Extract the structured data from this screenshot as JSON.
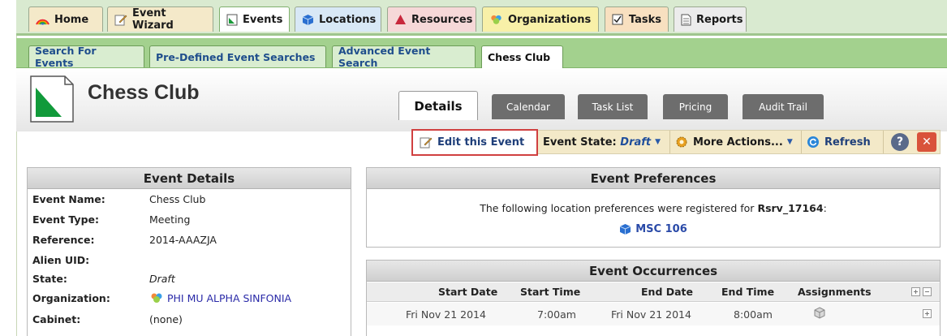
{
  "nav": {
    "tabs": [
      {
        "label": "Home",
        "icon": "rainbow-icon",
        "bg": "#f4e9c9"
      },
      {
        "label": "Event Wizard",
        "icon": "pencil-icon",
        "bg": "#f4e9c9"
      },
      {
        "label": "Events",
        "icon": "document-icon",
        "bg": "#ffffff"
      },
      {
        "label": "Locations",
        "icon": "cube-icon",
        "bg": "#d8e8f6"
      },
      {
        "label": "Resources",
        "icon": "triangle-icon",
        "bg": "#f6d8d8"
      },
      {
        "label": "Organizations",
        "icon": "people-icon",
        "bg": "#f8f0a8"
      },
      {
        "label": "Tasks",
        "icon": "checkbox-icon",
        "bg": "#f8e0c0"
      },
      {
        "label": "Reports",
        "icon": "report-icon",
        "bg": "#ececec"
      }
    ]
  },
  "subnav": {
    "tabs": [
      "Search For Events",
      "Pre-Defined Event Searches",
      "Advanced Event Search",
      "Chess Club"
    ]
  },
  "page_title": "Chess Club",
  "detail_tabs": [
    "Details",
    "Calendar",
    "Task List",
    "Pricing",
    "Audit Trail"
  ],
  "actions": {
    "edit": "Edit this Event",
    "state_label": "Event State:",
    "state_value": "Draft",
    "more": "More Actions...",
    "refresh": "Refresh"
  },
  "event_details": {
    "title": "Event Details",
    "rows": [
      {
        "key": "Event Name:",
        "value": "Chess Club"
      },
      {
        "key": "Event Type:",
        "value": "Meeting"
      },
      {
        "key": "Reference:",
        "value": "2014-AAAZJA"
      },
      {
        "key": "Alien UID:",
        "value": ""
      },
      {
        "key": "State:",
        "value": "Draft"
      },
      {
        "key": "Organization:",
        "value": "PHI MU ALPHA SINFONIA"
      },
      {
        "key": "Cabinet:",
        "value": "(none)"
      }
    ]
  },
  "event_preferences": {
    "title": "Event Preferences",
    "text": "The following location preferences were registered for",
    "reservation": "Rsrv_17164",
    "reservation_suffix": ":",
    "location": "MSC 106"
  },
  "event_occurrences": {
    "title": "Event Occurrences",
    "columns": [
      "Start Date",
      "Start Time",
      "End Date",
      "End Time",
      "Assignments"
    ],
    "rows": [
      {
        "start_date": "Fri Nov 21 2014",
        "start_time": "7:00am",
        "end_date": "Fri Nov 21 2014",
        "end_time": "8:00am"
      }
    ]
  }
}
